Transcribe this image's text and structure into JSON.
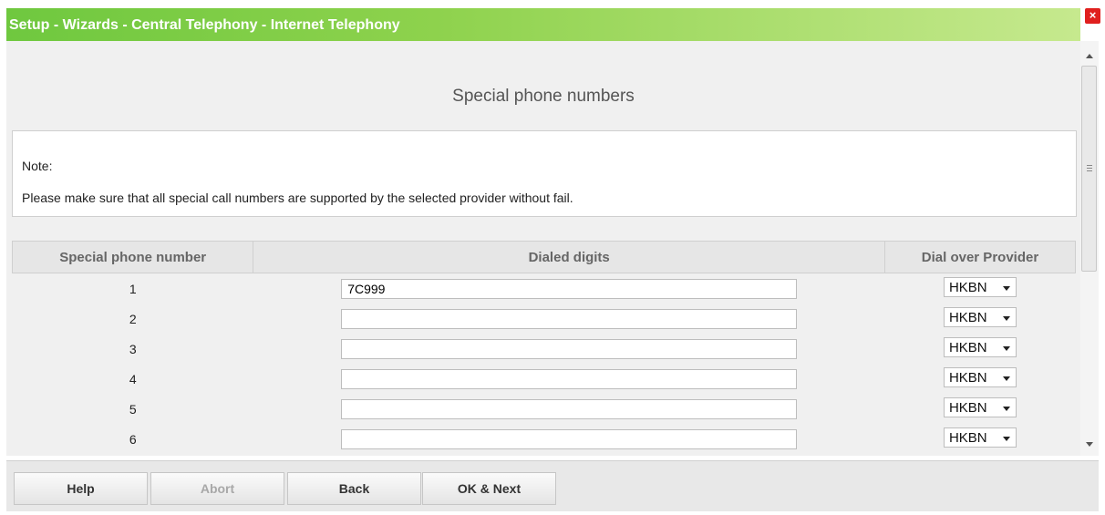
{
  "window": {
    "title": "Setup - Wizards - Central Telephony - Internet Telephony",
    "close_label": "×"
  },
  "page": {
    "heading": "Special phone numbers",
    "note_label": "Note:",
    "note_text": "Please make sure that all special call numbers are supported by the selected provider without fail."
  },
  "table": {
    "headers": [
      "Special phone number",
      "Dialed digits",
      "Dial over Provider"
    ],
    "rows": [
      {
        "number": "1",
        "digits": "7C999",
        "provider": "HKBN"
      },
      {
        "number": "2",
        "digits": "",
        "provider": "HKBN"
      },
      {
        "number": "3",
        "digits": "",
        "provider": "HKBN"
      },
      {
        "number": "4",
        "digits": "",
        "provider": "HKBN"
      },
      {
        "number": "5",
        "digits": "",
        "provider": "HKBN"
      },
      {
        "number": "6",
        "digits": "",
        "provider": "HKBN"
      }
    ]
  },
  "buttons": {
    "help": "Help",
    "abort": "Abort",
    "back": "Back",
    "ok_next": "OK & Next"
  },
  "colors": {
    "titlebar": "#6fc83f",
    "close": "#e0201e"
  }
}
